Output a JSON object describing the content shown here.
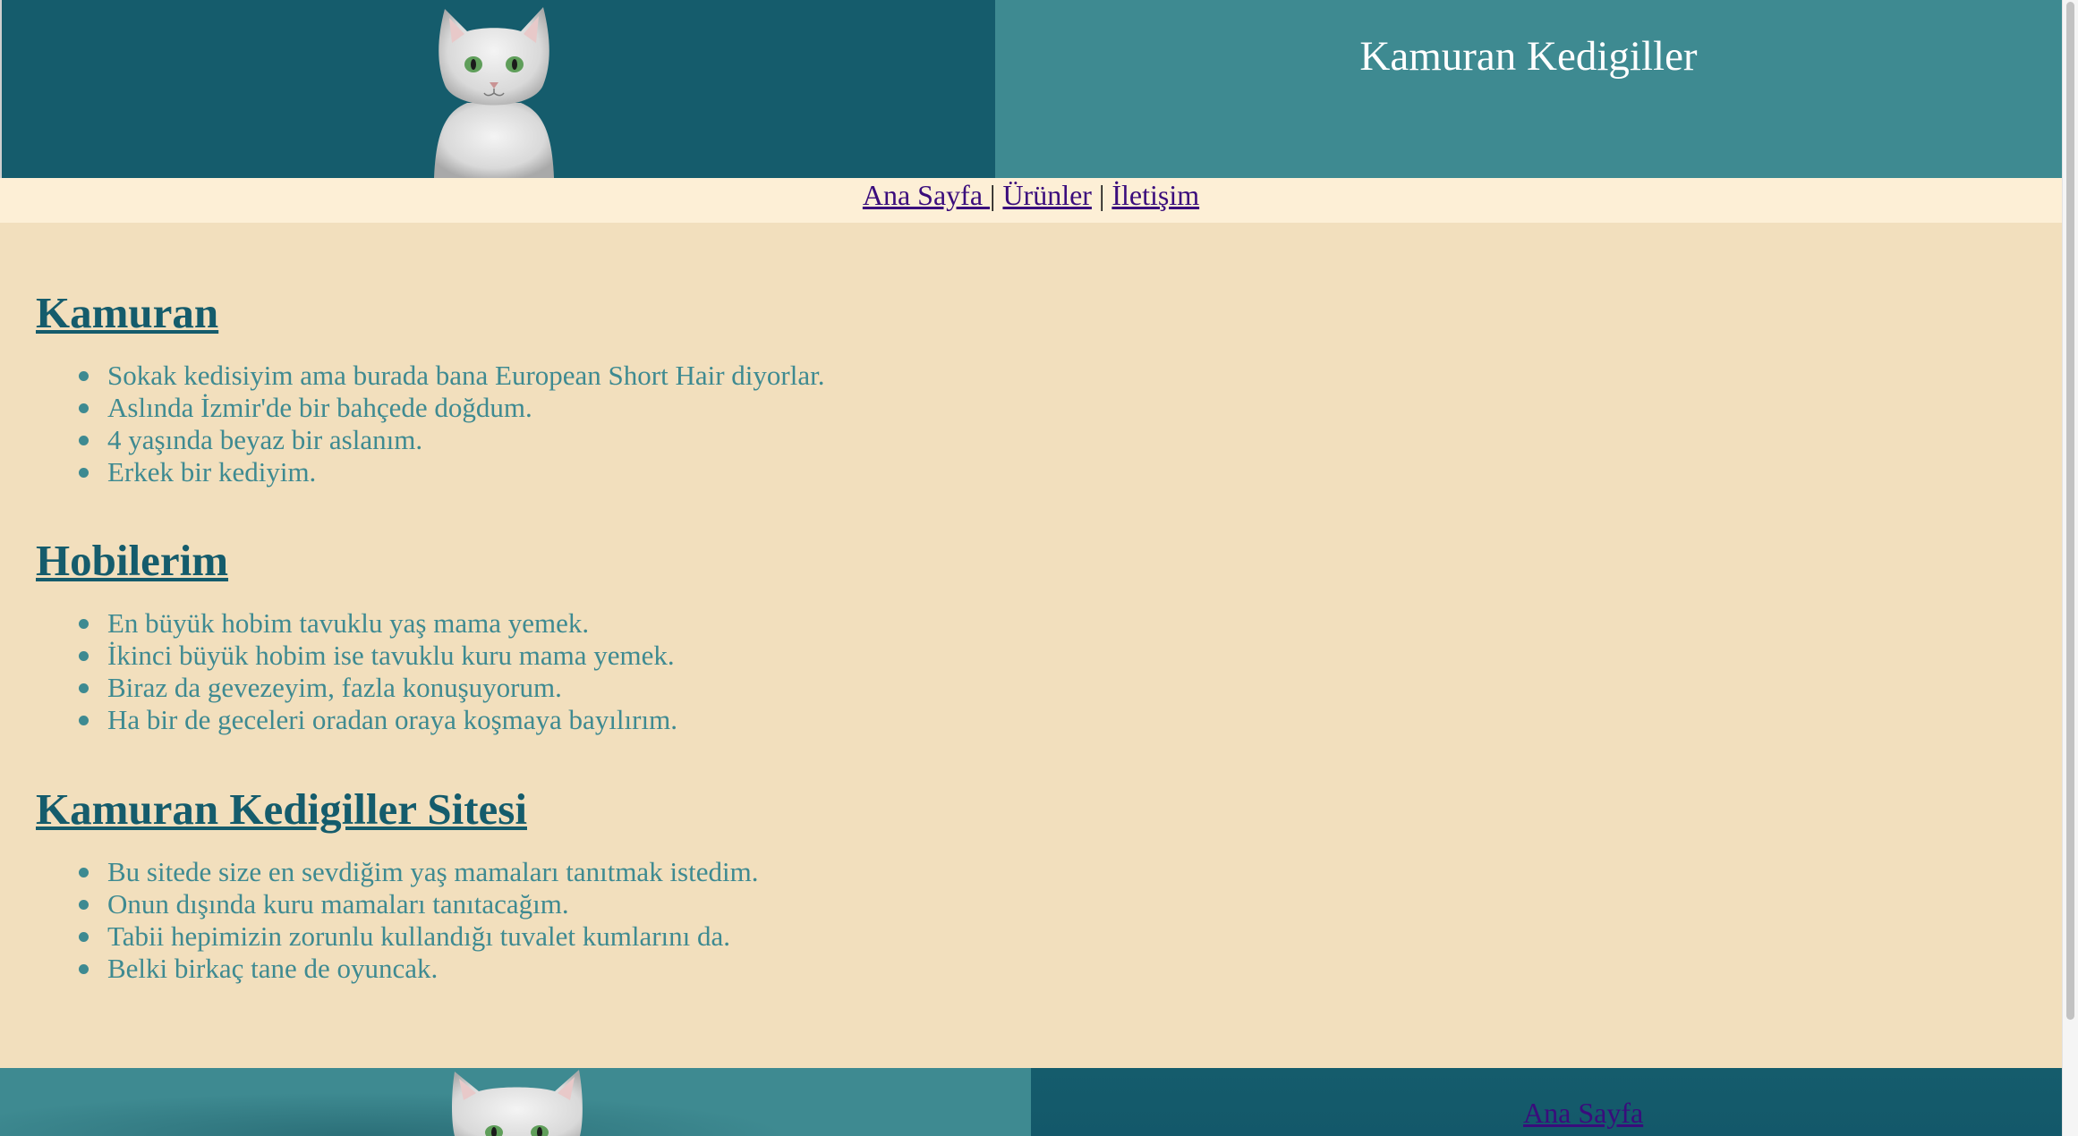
{
  "header": {
    "title": "Kamuran Kedigiller",
    "logo": "cat-photo"
  },
  "nav": {
    "home": "Ana Sayfa ",
    "products": "Ürünler",
    "contact": "İletişim",
    "separator": "|"
  },
  "sections": [
    {
      "title": "Kamuran",
      "items": [
        "Sokak kedisiyim ama burada bana European Short Hair diyorlar.",
        "Aslında İzmir'de bir bahçede doğdum.",
        "4 yaşında beyaz bir aslanım.",
        "Erkek bir kediyim."
      ]
    },
    {
      "title": "Hobilerim",
      "items": [
        "En büyük hobim tavuklu yaş mama yemek.",
        "İkinci büyük hobim ise tavuklu kuru mama yemek.",
        "Biraz da gevezeyim, fazla konuşuyorum.",
        "Ha bir de geceleri oradan oraya koşmaya bayılırım."
      ]
    },
    {
      "title": "Kamuran Kedigiller Sitesi",
      "items": [
        "Bu sitede size en sevdiğim yaş mamaları tanıtmak istedim.",
        "Onun dışında kuru mamaları tanıtacağım.",
        "Tabii hepimizin zorunlu kullandığı tuvalet kumlarını da.",
        "Belki birkaç tane de oyuncak."
      ]
    }
  ],
  "footer": {
    "home_link": "Ana Sayfa"
  },
  "colors": {
    "dark_teal": "#155c6c",
    "teal": "#3e8a91",
    "page_bg": "#f2dfbd",
    "nav_bg": "#fdefd6",
    "link": "#3a0c7c"
  }
}
